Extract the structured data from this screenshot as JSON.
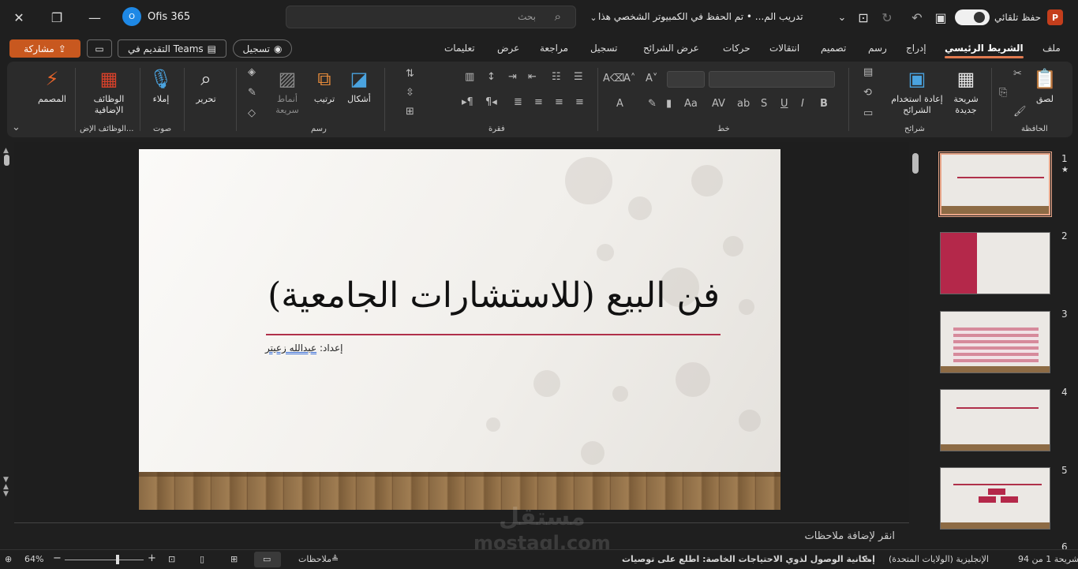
{
  "window": {
    "user_name": "Ofis 365",
    "user_avatar_letter": "O",
    "search_placeholder": "بحث",
    "doc_title": "تدريب الم... • تم الحفظ في الكمبيوتر الشخصي هذا",
    "autosave_label": "حفظ تلقائي",
    "app_badge": "P"
  },
  "tabs": [
    "ملف",
    "الشريط الرئيسي",
    "إدراج",
    "رسم",
    "تصميم",
    "انتقالات",
    "حركات",
    "عرض الشرائح",
    "تسجيل",
    "مراجعة",
    "عرض",
    "تعليمات"
  ],
  "actions": {
    "share_label": "مشاركة",
    "present_teams_label": "التقديم في Teams",
    "record_label": "تسجيل"
  },
  "ribbon": {
    "clipboard": {
      "paste": "لصق",
      "group": "الحافظة"
    },
    "slides": {
      "new_slide": "شريحة جديدة",
      "reuse": "إعادة استخدام الشرائح",
      "group": "شرائح"
    },
    "font": {
      "group": "خط"
    },
    "paragraph": {
      "group": "فقرة"
    },
    "drawing": {
      "shapes": "أشكال",
      "arrange": "ترتيب",
      "quick_styles": "أنماط سريعة",
      "group": "رسم"
    },
    "editing": {
      "edit": "تحرير"
    },
    "voice": {
      "dictate": "إملاء",
      "group": "صوت"
    },
    "addins": {
      "addins": "الوظائف الإضافية",
      "group": "الوظائف الإض..."
    },
    "designer": {
      "designer": "المصمم"
    }
  },
  "slide": {
    "title": "فن البيع (للاستشارات الجامعية)",
    "subtitle_prefix": "إعداد:",
    "subtitle_name": "عبدالله زعيتر"
  },
  "thumbnails": [
    {
      "num": "1",
      "star": "★"
    },
    {
      "num": "2"
    },
    {
      "num": "3"
    },
    {
      "num": "4"
    },
    {
      "num": "5"
    },
    {
      "num": "6"
    }
  ],
  "notes_placeholder": "انقر لإضافة ملاحظات",
  "status": {
    "slide_count": "شريحة 1 من 94",
    "language": "الإنجليزية (الولايات المتحدة)",
    "accessibility": "إمكانية الوصول لذوي الاحتياجات الخاصة: اطلع على توصيات",
    "notes_label": "ملاحظات",
    "zoom": "64%"
  },
  "watermark": {
    "line1": "مستقل",
    "line2": "mostaql.com"
  },
  "colors": {
    "accent": "#c8581f",
    "active_tab_underline": "#e07a4f",
    "slide_rule": "#b0304a"
  }
}
